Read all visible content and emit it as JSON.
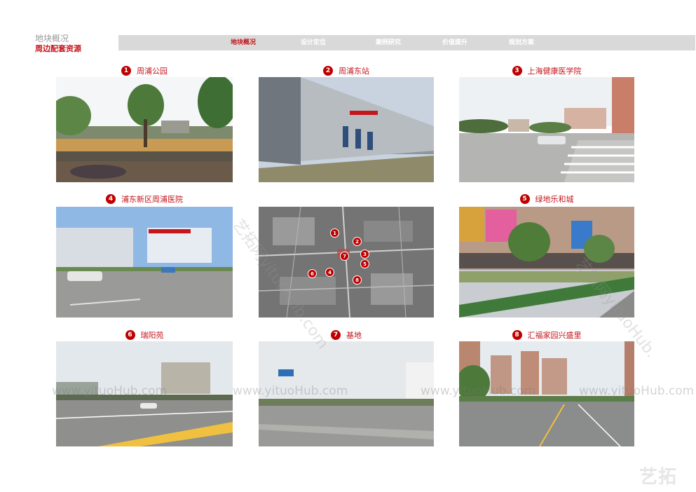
{
  "header": {
    "category": "地块概况",
    "subtitle": "周边配套资源"
  },
  "nav": {
    "items": [
      {
        "label": "地块概况",
        "active": true
      },
      {
        "label": "设计定位",
        "active": false
      },
      {
        "label": "案例研究",
        "active": false
      },
      {
        "label": "价值提升",
        "active": false
      },
      {
        "label": "规划方案",
        "active": false
      }
    ]
  },
  "photos": [
    {
      "number": "1",
      "caption": "周浦公园"
    },
    {
      "number": "2",
      "caption": "周浦东站"
    },
    {
      "number": "3",
      "caption": "上海健康医学院"
    },
    {
      "number": "4",
      "caption": "浦东新区周浦医院"
    },
    {
      "number": "5",
      "caption": "绿地乐和城"
    },
    {
      "number": "6",
      "caption": "瑞阳苑"
    },
    {
      "number": "7",
      "caption": "基地"
    },
    {
      "number": "8",
      "caption": "汇福家园兴盛里"
    }
  ],
  "map": {
    "markers": [
      "1",
      "2",
      "3",
      "4",
      "5",
      "6",
      "7",
      "8"
    ]
  },
  "watermark": {
    "text": "www.yituoHub.com",
    "rotated_text": "艺拓网yituoHub.",
    "rotated_text_left": "艺拓网yituoHub.com"
  },
  "brand": {
    "logo_text": "艺拓"
  },
  "colors": {
    "accent": "#c4161c",
    "badge": "#c00000",
    "nav_bg": "#d9d9d9"
  }
}
